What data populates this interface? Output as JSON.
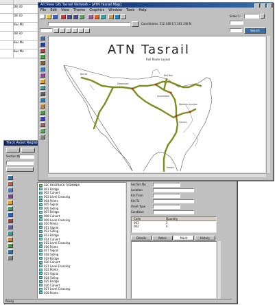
{
  "background_sheet": {
    "rows": [
      "DB 3D",
      "DB 3D",
      "Bus Ma",
      "DB 3D",
      "Bus Ma",
      "Bus Ma"
    ]
  },
  "main_window": {
    "title": "ArcView GIS Tasrail Network - [ATN Tasrail Map]",
    "menu": [
      "File",
      "Edit",
      "View",
      "Theme",
      "Graphics",
      "Window",
      "Tools",
      "Help"
    ],
    "search_field": "",
    "side_field_label": "Scale 1:",
    "side_button": "Search",
    "status_text": "Coordinates: 512 430 E 5 361 240 N",
    "map": {
      "title": "ATN Tasrail",
      "subtitle": "Rail Route Layout",
      "accent_color": "#7f8c1f",
      "station_labels": [
        "Burnie",
        "Devonport",
        "Launceston",
        "Bell Bay",
        "Western Junction",
        "Conara",
        "Hobart"
      ]
    }
  },
  "lower_window": {
    "title": "Track Asset Register - Section Browser",
    "input_label": "Section No.",
    "tree_header": "SEC RAILTRACK TASMANIA",
    "tree_items": [
      "001 Bridge",
      "002 Culvert",
      "003 Level Crossing",
      "004 Points",
      "005 Signal",
      "006 Siding",
      "007 Bridge",
      "008 Culvert",
      "009 Level Crossing",
      "010 Points",
      "011 Signal",
      "012 Siding",
      "013 Bridge",
      "014 Culvert",
      "015 Level Crossing",
      "016 Points",
      "017 Signal",
      "018 Siding",
      "019 Bridge",
      "020 Culvert",
      "021 Level Crossing",
      "022 Points",
      "023 Signal",
      "024 Siding",
      "025 Bridge",
      "026 Culvert",
      "027 Level Crossing",
      "028 Points"
    ],
    "properties": [
      {
        "label": "Section No.",
        "value": ""
      },
      {
        "label": "Location",
        "value": ""
      },
      {
        "label": "Km From",
        "value": ""
      },
      {
        "label": "Km To",
        "value": ""
      },
      {
        "label": "Asset Type",
        "value": ""
      },
      {
        "label": "Condition",
        "value": ""
      }
    ],
    "grid": {
      "headers": [
        "Code",
        "Quantity"
      ],
      "rows": [
        [
          "001",
          "3"
        ],
        [
          "002",
          "4"
        ]
      ]
    },
    "bottom_tabs": [
      "Details",
      "Notes",
      "Maint",
      "History"
    ],
    "status_text": "Ready"
  }
}
